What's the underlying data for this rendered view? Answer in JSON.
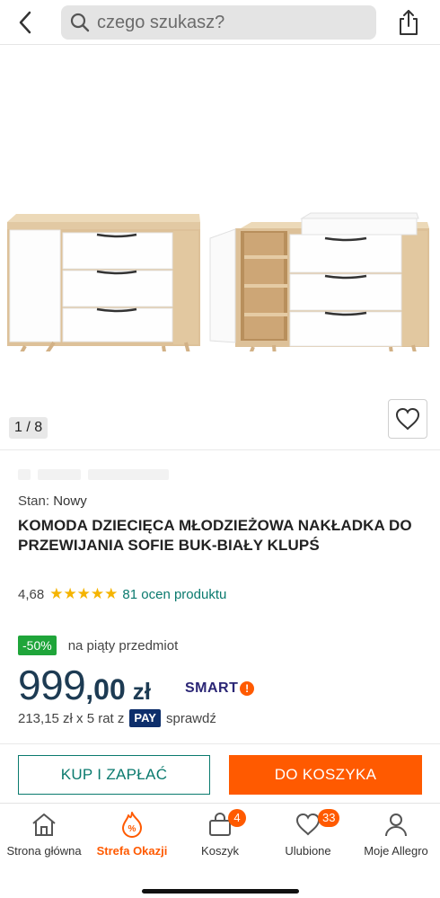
{
  "search": {
    "placeholder": "czego szukasz?"
  },
  "gallery": {
    "counter": "1 / 8"
  },
  "product": {
    "condition_label": "Stan:",
    "condition_value": "Nowy",
    "title": "KOMODA DZIECIĘCA MŁODZIEŻOWA NAKŁADKA DO PRZEWIJANIA SOFIE BUK-BIAŁY KLUPŚ",
    "rating_value": "4,68",
    "rating_stars": 5,
    "reviews": "81 ocen produktu"
  },
  "promo": {
    "badge": "-50%",
    "text": "na piąty przedmiot"
  },
  "price": {
    "integer": "999",
    "decimal": ",00",
    "currency": "zł",
    "smart_label": "SMART"
  },
  "installments": {
    "text": "213,15 zł x 5 rat z",
    "pay_label": "PAY",
    "check": "sprawdź"
  },
  "buttons": {
    "buy": "KUP I ZAPŁAĆ",
    "cart": "DO KOSZYKA"
  },
  "nav": {
    "items": [
      {
        "label": "Strona główna",
        "icon": "home-icon"
      },
      {
        "label": "Strefa Okazji",
        "icon": "deals-icon",
        "active": true
      },
      {
        "label": "Koszyk",
        "icon": "cart-icon",
        "badge": "4"
      },
      {
        "label": "Ulubione",
        "icon": "heart-icon",
        "badge": "33"
      },
      {
        "label": "Moje Allegro",
        "icon": "user-icon"
      }
    ]
  },
  "colors": {
    "accent": "#ff5a00",
    "teal": "#0a7a6e",
    "green_badge": "#1fa53a",
    "price": "#1d3b53"
  }
}
